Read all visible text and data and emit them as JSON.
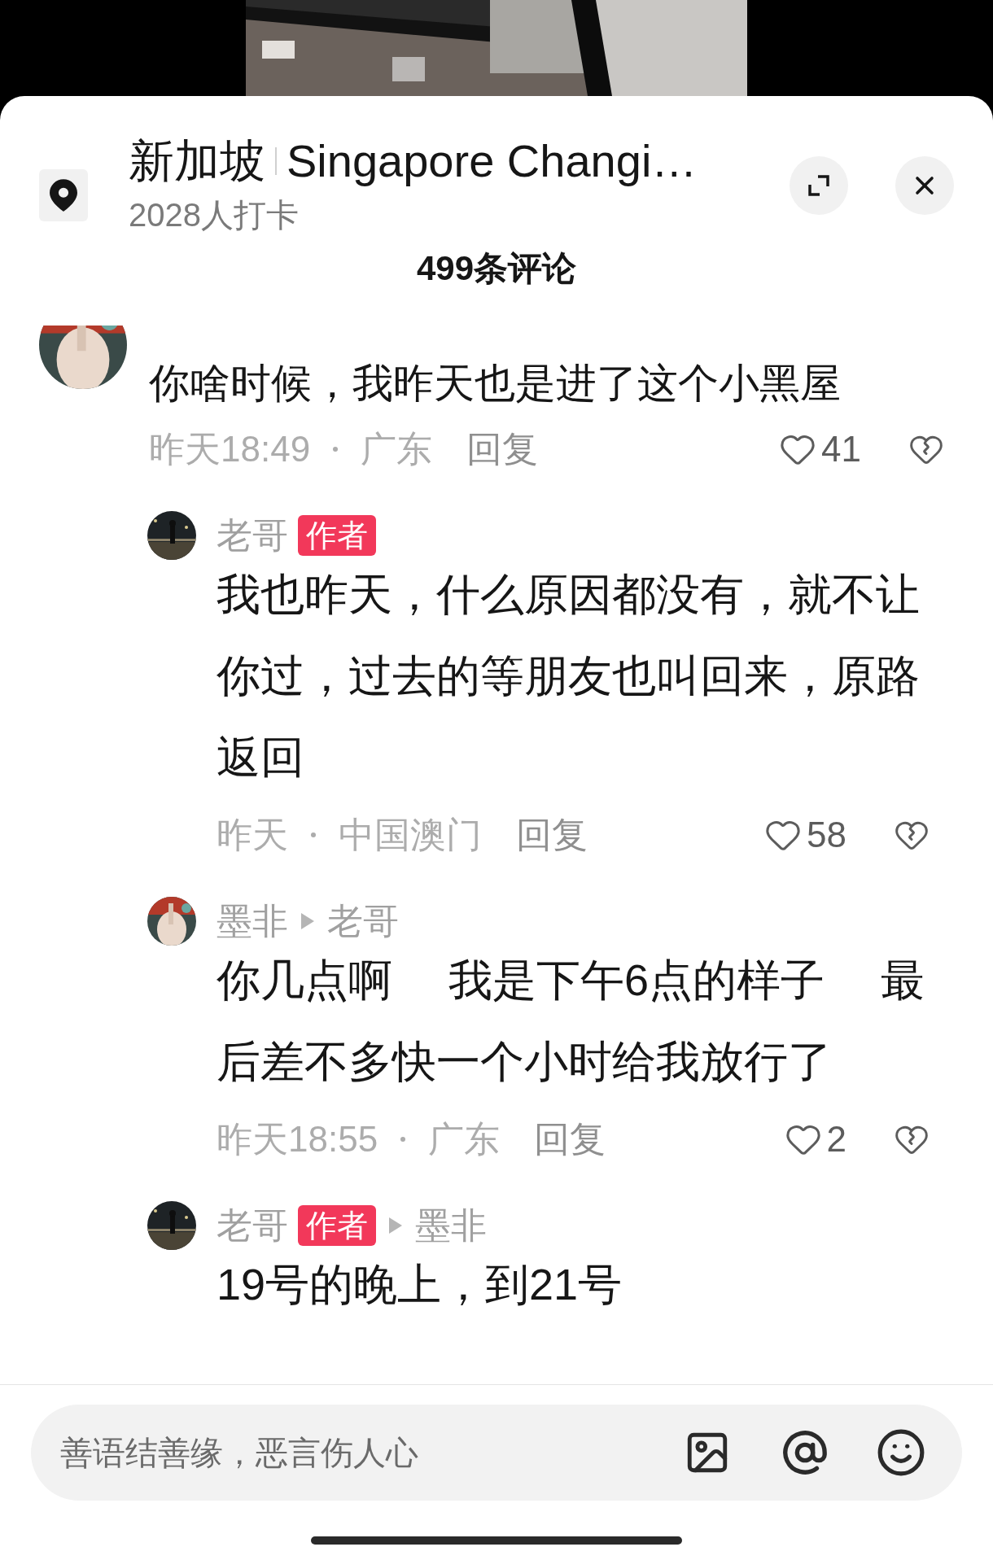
{
  "header": {
    "place_name": "新加坡",
    "place_name_en": "Singapore Changi…",
    "checkins": "2028人打卡"
  },
  "comment_count": "499条评论",
  "comments": [
    {
      "text": "你啥时候，我昨天也是进了这个小黑屋",
      "time": "昨天18:49",
      "region": "广东",
      "reply": "回复",
      "likes": "41",
      "replies": [
        {
          "name": "老哥",
          "badge": "作者",
          "text": "我也昨天，什么原因都没有，就不让你过，过去的等朋友也叫回来，原路返回",
          "time": "昨天",
          "region": "中国澳门",
          "reply": "回复",
          "likes": "58"
        },
        {
          "name": "墨非",
          "reply_to": "老哥",
          "text": "你几点啊　 我是下午6点的样子　 最后差不多快一个小时给我放行了",
          "time": "昨天18:55",
          "region": "广东",
          "reply": "回复",
          "likes": "2"
        },
        {
          "name": "老哥",
          "badge": "作者",
          "reply_to": "墨非",
          "text": "19号的晚上，到21号"
        }
      ]
    }
  ],
  "input": {
    "placeholder": "善语结善缘，恶言伤人心"
  }
}
